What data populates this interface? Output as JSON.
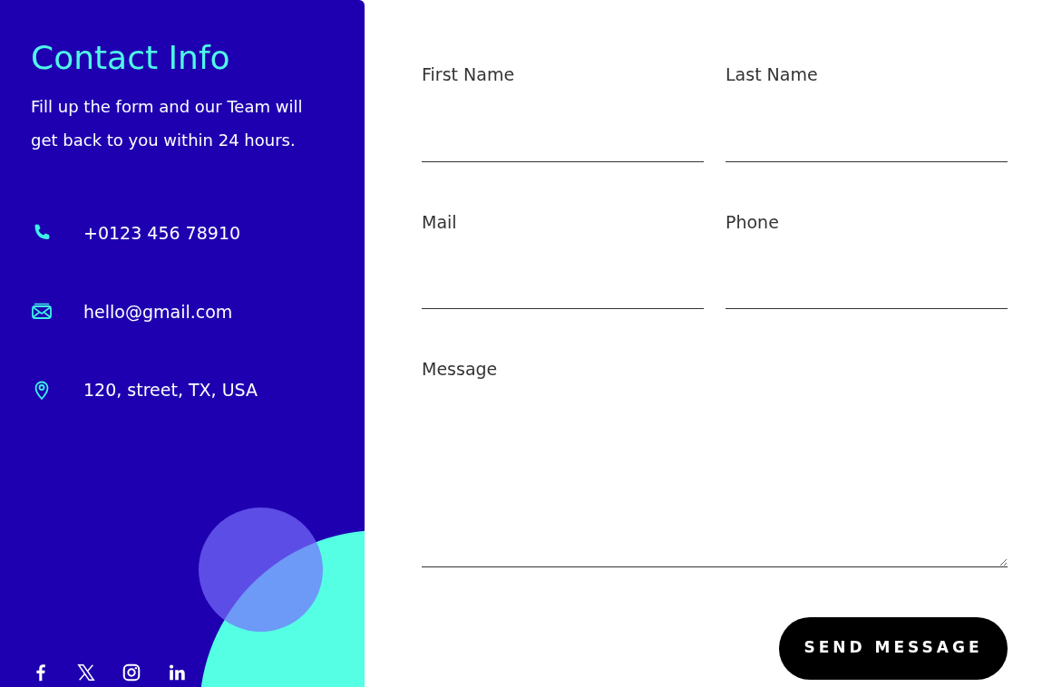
{
  "contact_info": {
    "title": "Contact Info",
    "description": "Fill up the form and our Team will get back to you within 24 hours.",
    "items": [
      {
        "kind": "phone",
        "text": "+0123 456 78910"
      },
      {
        "kind": "mail",
        "text": "hello@gmail.com"
      },
      {
        "kind": "location",
        "text": "120, street, TX, USA"
      }
    ],
    "social_links": [
      {
        "kind": "facebook"
      },
      {
        "kind": "x"
      },
      {
        "kind": "instagram"
      },
      {
        "kind": "linkedin"
      }
    ]
  },
  "form": {
    "fields": [
      {
        "kind": "input",
        "label": "First Name"
      },
      {
        "kind": "input",
        "label": "Last Name"
      },
      {
        "kind": "input",
        "label": "Mail"
      },
      {
        "kind": "input",
        "label": "Phone"
      },
      {
        "kind": "textarea",
        "label": "Message"
      }
    ],
    "submit": "SEND MESSAGE"
  }
}
